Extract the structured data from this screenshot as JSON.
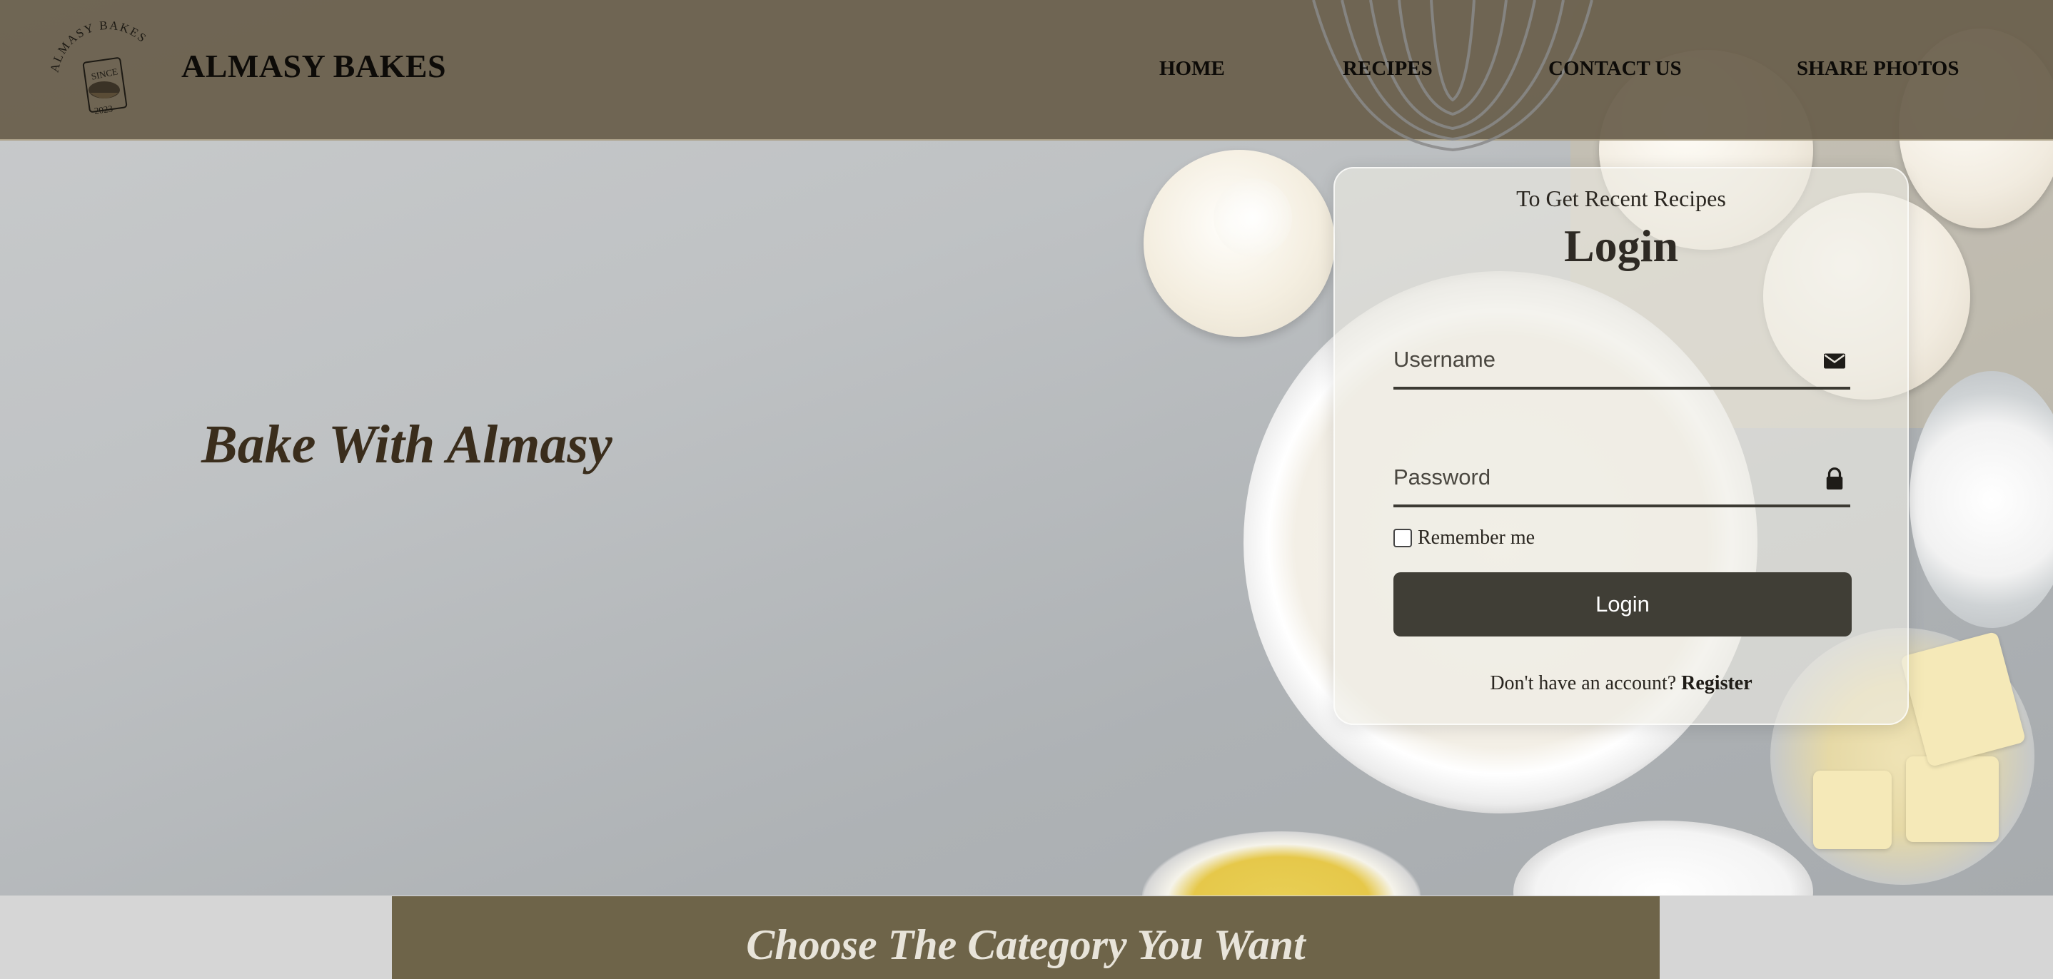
{
  "header": {
    "brand": "ALMASY BAKES",
    "logo_text_top": "ALMASY BAKES",
    "logo_text_since": "SINCE",
    "logo_text_year": "2023",
    "nav": [
      {
        "label": "HOME"
      },
      {
        "label": "RECIPES"
      },
      {
        "label": "CONTACT US"
      },
      {
        "label": "SHARE PHOTOS"
      }
    ]
  },
  "hero": {
    "title": "Bake With Almasy"
  },
  "login": {
    "subtitle": "To Get Recent Recipes",
    "title": "Login",
    "username_placeholder": "Username",
    "password_placeholder": "Password",
    "username_icon": "envelope-icon",
    "password_icon": "lock-icon",
    "remember_label": "Remember me",
    "button_label": "Login",
    "register_prompt": "Don't have an account?",
    "register_link": "Register"
  },
  "category": {
    "title": "Choose The Category You Want"
  },
  "colors": {
    "header_bg": "#685e4a",
    "button_bg": "#403e36",
    "category_bg": "#6e6449",
    "hero_title": "#3a2d1c"
  }
}
